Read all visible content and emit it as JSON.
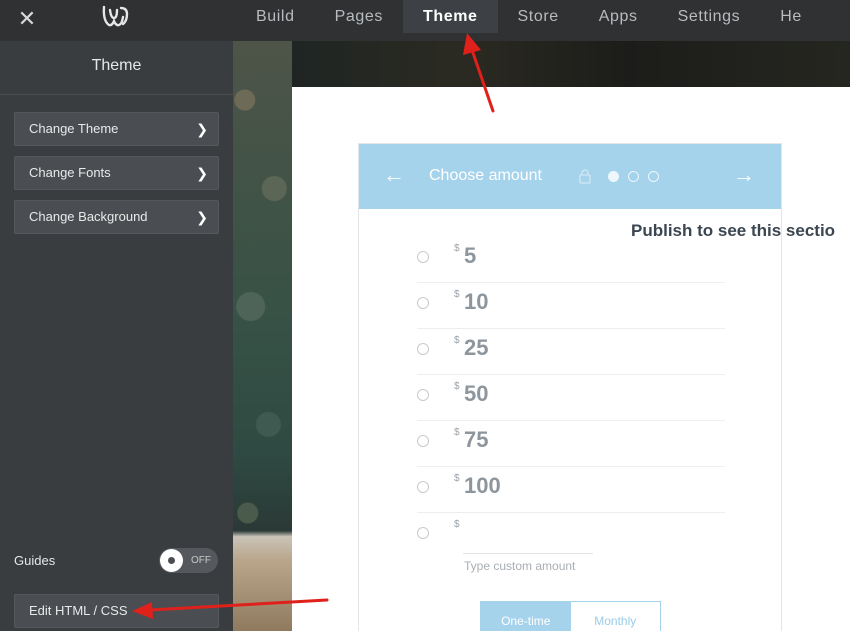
{
  "topbar": {
    "close_label": "✕",
    "nav": [
      {
        "label": "Build"
      },
      {
        "label": "Pages"
      },
      {
        "label": "Theme",
        "active": true
      },
      {
        "label": "Store"
      },
      {
        "label": "Apps"
      },
      {
        "label": "Settings"
      },
      {
        "label": "He"
      }
    ]
  },
  "sidebar": {
    "title": "Theme",
    "buttons": [
      {
        "label": "Change Theme"
      },
      {
        "label": "Change Fonts"
      },
      {
        "label": "Change Background"
      }
    ],
    "guides_label": "Guides",
    "guides_toggle": "OFF",
    "edit_label": "Edit HTML / CSS"
  },
  "widget": {
    "title": "Choose amount",
    "currency": "$",
    "amounts": [
      "5",
      "10",
      "25",
      "50",
      "75",
      "100"
    ],
    "custom_placeholder": "Type custom amount",
    "frequency": [
      "One-time",
      "Monthly"
    ]
  },
  "publish_note": "Publish to see this sectio",
  "colors": {
    "accent": "#a6d3ec",
    "arrow": "#e0201a",
    "topbar": "#2f3133",
    "sidebar": "#3a3d40"
  }
}
